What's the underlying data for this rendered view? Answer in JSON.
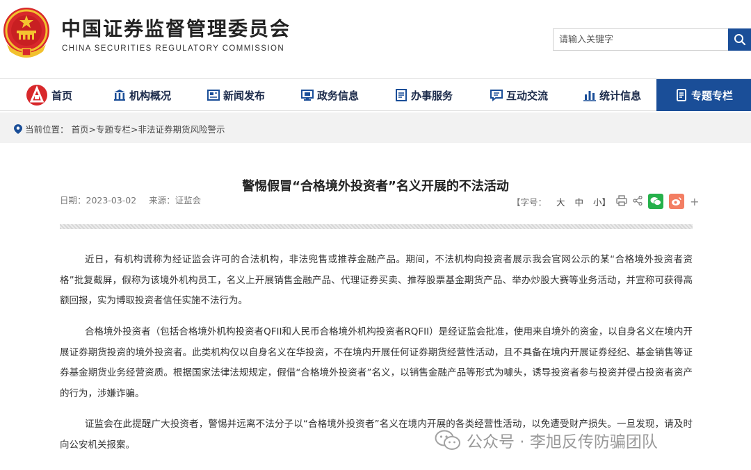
{
  "header": {
    "title_cn": "中国证券监督管理委员会",
    "title_en": "CHINA SECURITIES REGULATORY COMMISSION",
    "search_placeholder": "请输入关键字"
  },
  "nav": {
    "items": [
      {
        "label": "首页",
        "icon": "emblem-icon"
      },
      {
        "label": "机构概况",
        "icon": "building-icon"
      },
      {
        "label": "新闻发布",
        "icon": "newspaper-icon"
      },
      {
        "label": "政务信息",
        "icon": "monitor-icon"
      },
      {
        "label": "办事服务",
        "icon": "document-icon"
      },
      {
        "label": "互动交流",
        "icon": "chat-icon"
      },
      {
        "label": "统计信息",
        "icon": "bar-chart-icon"
      },
      {
        "label": "专题专栏",
        "icon": "book-icon",
        "active": true
      }
    ],
    "active_color": "#1a4e98"
  },
  "breadcrumb": {
    "label": "当前位置：",
    "path": "首页>专题专栏>非法证券期货风险警示"
  },
  "article": {
    "title": "警惕假冒“合格境外投资者”名义开展的不法活动",
    "date": "日期：2023-03-02",
    "source": "来源：证监会",
    "font_label": "【字号：",
    "font_large": "大",
    "font_medium": "中",
    "font_small": "小】",
    "paragraphs": [
      "近日，有机构谎称为经证监会许可的合法机构，非法兜售或推荐金融产品。期间，不法机构向投资者展示我会官网公示的某“合格境外投资者资格”批复截屏，假称为该境外机构员工，名义上开展销售金融产品、代理证券买卖、推荐股票基金期货产品、举办炒股大赛等业务活动，并宣称可获得高额回报，实为博取投资者信任实施不法行为。",
      "合格境外投资者（包括合格境外机构投资者QFII和人民币合格境外机构投资者RQFII）是经证监会批准，使用来自境外的资金，以自身名义在境内开展证券期货投资的境外投资者。此类机构仅以自身名义在华投资，不在境内开展任何证券期货经营性活动，且不具备在境内开展证券经纪、基金销售等证券基金期货业务经营资质。根据国家法律法规规定，假借“合格境外投资者”名义，以销售金融产品等形式为噱头，诱导投资者参与投资并侵占投资者资产的行为，涉嫌诈骗。",
      "证监会在此提醒广大投资者，警惕并远离不法分子以“合格境外投资者”名义在境内开展的各类经营性活动，以免遭受财产损失。一旦发现，请及时向公安机关报案。"
    ]
  },
  "watermark": {
    "text": "公众号 · 李旭反传防骗团队"
  }
}
